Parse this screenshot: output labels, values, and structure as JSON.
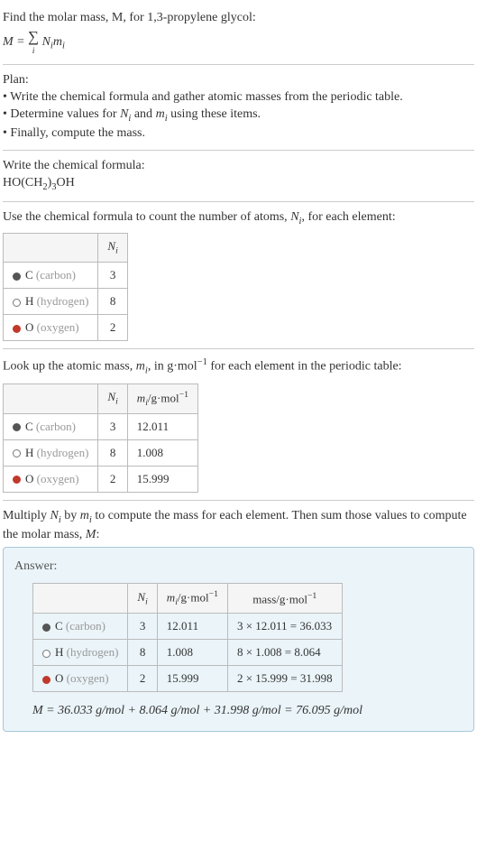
{
  "intro": {
    "find_line": "Find the molar mass, M, for 1,3-propylene glycol:",
    "eq_lhs": "M = ",
    "eq_rhs": " N",
    "eq_rhs2": "m",
    "sum_index": "i"
  },
  "plan": {
    "heading": "Plan:",
    "b1": "• Write the chemical formula and gather atomic masses from the periodic table.",
    "b2_a": "• Determine values for ",
    "b2_n": "N",
    "b2_and": " and ",
    "b2_m": "m",
    "b2_end": " using these items.",
    "b3": "• Finally, compute the mass."
  },
  "formula": {
    "heading": "Write the chemical formula:",
    "f1": "HO(CH",
    "f2": "2",
    "f3": ")",
    "f4": "3",
    "f5": "OH"
  },
  "count": {
    "heading_a": "Use the chemical formula to count the number of atoms, ",
    "heading_n": "N",
    "heading_b": ", for each element:",
    "h_n": "N",
    "e1": "C",
    "e1p": " (carbon)",
    "n1": "3",
    "e2": "H",
    "e2p": " (hydrogen)",
    "n2": "8",
    "e3": "O",
    "e3p": " (oxygen)",
    "n3": "2"
  },
  "mass": {
    "heading_a": "Look up the atomic mass, ",
    "heading_m": "m",
    "heading_b": ", in g·mol",
    "heading_exp": "−1",
    "heading_c": " for each element in the periodic table:",
    "h_n": "N",
    "h_m": "m",
    "h_unit": "/g·mol",
    "h_exp": "−1",
    "m1": "12.011",
    "m2": "1.008",
    "m3": "15.999"
  },
  "mult": {
    "a": "Multiply ",
    "n": "N",
    "by": " by ",
    "m": "m",
    "end": " to compute the mass for each element. Then sum those values to compute the molar mass, ",
    "Mv": "M",
    ":": ":"
  },
  "answer": {
    "label": "Answer:",
    "h_n": "N",
    "h_m": "m",
    "h_mass": "mass/g·mol",
    "h_unit": "/g·mol",
    "h_exp": "−1",
    "r1": "3 × 12.011 = 36.033",
    "r2": "8 × 1.008 = 8.064",
    "r3": "2 × 15.999 = 31.998",
    "final": "M = 36.033 g/mol + 8.064 g/mol + 31.998 g/mol = 76.095 g/mol"
  }
}
